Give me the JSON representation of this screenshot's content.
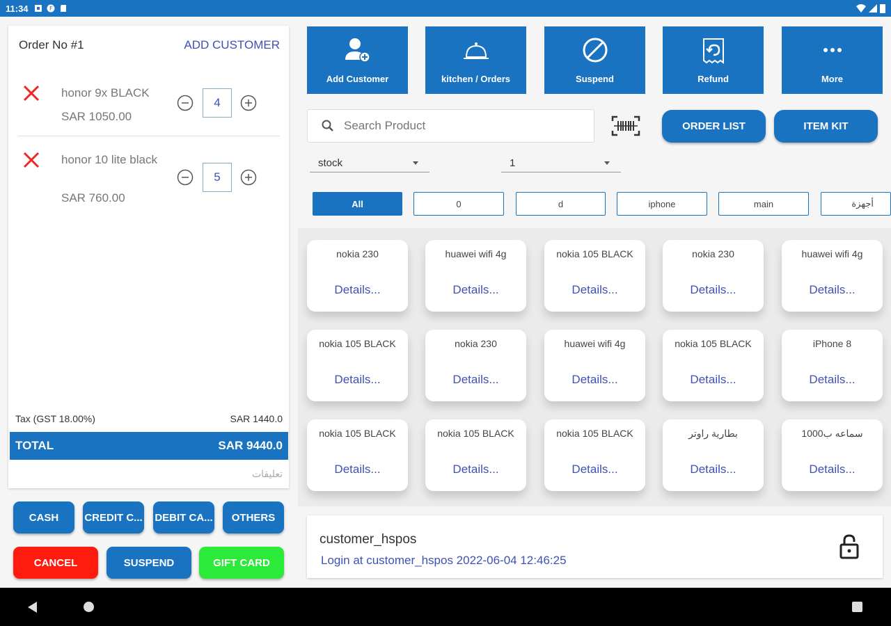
{
  "status_bar": {
    "time": "11:34"
  },
  "order": {
    "title": "Order No #1",
    "add_customer_link": "ADD CUSTOMER",
    "items": [
      {
        "name": "honor 9x BLACK",
        "price": "SAR 1050.00",
        "qty": "4"
      },
      {
        "name": "honor 10 lite black",
        "price": "SAR 760.00",
        "qty": "5"
      }
    ],
    "tax_label": "Tax (GST 18.00%)",
    "tax_value": "SAR 1440.0",
    "total_label": "TOTAL",
    "total_value": "SAR 9440.0",
    "notes_placeholder": "تعليقات"
  },
  "payment": {
    "cash": "CASH",
    "credit": "CREDIT C...",
    "debit": "DEBIT CA...",
    "others": "OTHERS",
    "cancel": "CANCEL",
    "suspend": "SUSPEND",
    "gift_card": "GIFT CARD"
  },
  "tiles": [
    {
      "label": "Add Customer",
      "icon": "add-person-icon"
    },
    {
      "label": "kitchen / Orders",
      "icon": "cloche-icon"
    },
    {
      "label": "Suspend",
      "icon": "block-icon"
    },
    {
      "label": "Refund",
      "icon": "refund-receipt-icon"
    },
    {
      "label": "More",
      "icon": "more-dots-icon"
    }
  ],
  "search": {
    "placeholder": "Search Product"
  },
  "buttons": {
    "order_list": "ORDER LIST",
    "item_kit": "ITEM KIT"
  },
  "filters": {
    "stock": "stock",
    "qty": "1"
  },
  "categories": [
    "All",
    "0",
    "d",
    "iphone",
    "main",
    "أجهزة"
  ],
  "products": [
    [
      "nokia 230",
      "huawei wifi 4g",
      "nokia 105 BLACK",
      "nokia 230",
      "huawei wifi 4g"
    ],
    [
      "nokia 105 BLACK",
      "nokia 230",
      "huawei wifi 4g",
      "nokia 105 BLACK",
      "iPhone 8"
    ],
    [
      "nokia 105 BLACK",
      "nokia 105 BLACK",
      "nokia 105 BLACK",
      "بطارية راوتر",
      "1000سماعه ب"
    ]
  ],
  "details_label": "Details...",
  "user": {
    "name": "customer_hspos",
    "login_text": "Login at customer_hspos 2022-06-04 12:46:25"
  },
  "colors": {
    "primary": "#1a73c0",
    "cancel": "#ff1c0f",
    "gift": "#2bea3a",
    "link": "#3f51b5"
  }
}
